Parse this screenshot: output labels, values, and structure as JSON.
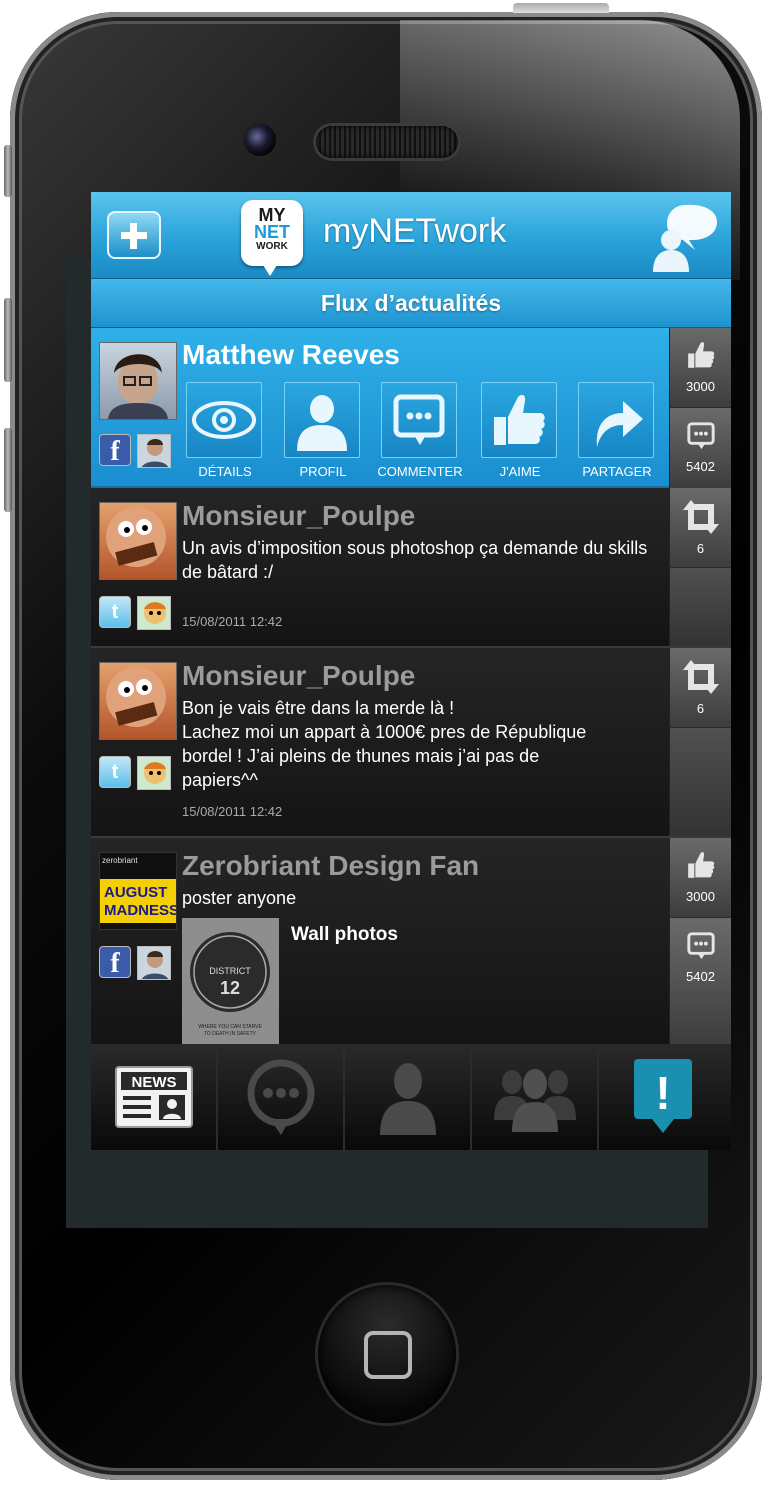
{
  "app": {
    "title": "myNETwork",
    "logo": {
      "line1": "MY",
      "line2": "NET",
      "line3": "WORK"
    },
    "section_title": "Flux d’actualités"
  },
  "colors": {
    "brand_blue": "#1f9ad6",
    "alert_teal": "#1a8fb0"
  },
  "header": {
    "add_icon": "plus-icon",
    "chat_icon": "chat-user-icon"
  },
  "feed": [
    {
      "author": "Matthew Reeves",
      "network": "facebook",
      "actions": [
        {
          "icon": "eye-icon",
          "label": "DÉTAILS"
        },
        {
          "icon": "user-icon",
          "label": "PROFIL"
        },
        {
          "icon": "comment-icon",
          "label": "COMMENTER"
        },
        {
          "icon": "thumbs-up-icon",
          "label": "J'AIME"
        },
        {
          "icon": "share-arrow-icon",
          "label": "PARTAGER"
        }
      ],
      "likes": "3000",
      "comments": "5402"
    },
    {
      "author": "Monsieur_Poulpe",
      "network": "twitter",
      "text": "Un avis d’imposition sous photoshop ça demande du skills de bâtard :/",
      "date": "15/08/2011 12:42",
      "retweets": "6"
    },
    {
      "author": "Monsieur_Poulpe",
      "network": "twitter",
      "text_lines": [
        "Bon je vais être dans la merde là !",
        "Lachez moi un appart à 1000€ pres de République",
        "bordel ! J’ai pleins de thunes mais j’ai pas de",
        "papiers^^"
      ],
      "date": "15/08/2011 12:42",
      "retweets": "6"
    },
    {
      "author": "Zerobriant Design Fan",
      "network": "facebook",
      "text": "poster anyone",
      "avatar_lines": [
        "zerobriant",
        "AUGUST",
        "MADNESS"
      ],
      "attachment_label": "Wall photos",
      "poster_lines": [
        "DISTRICT",
        "12",
        "WHERE YOU CAN STARVE",
        "TO DEATH IN SAFETY"
      ],
      "likes": "3000",
      "comments": "5402"
    }
  ],
  "tabbar": [
    {
      "icon": "news-icon",
      "label": "NEWS"
    },
    {
      "icon": "messages-icon"
    },
    {
      "icon": "profile-icon"
    },
    {
      "icon": "friends-icon"
    },
    {
      "icon": "alert-icon",
      "label": "!"
    }
  ]
}
